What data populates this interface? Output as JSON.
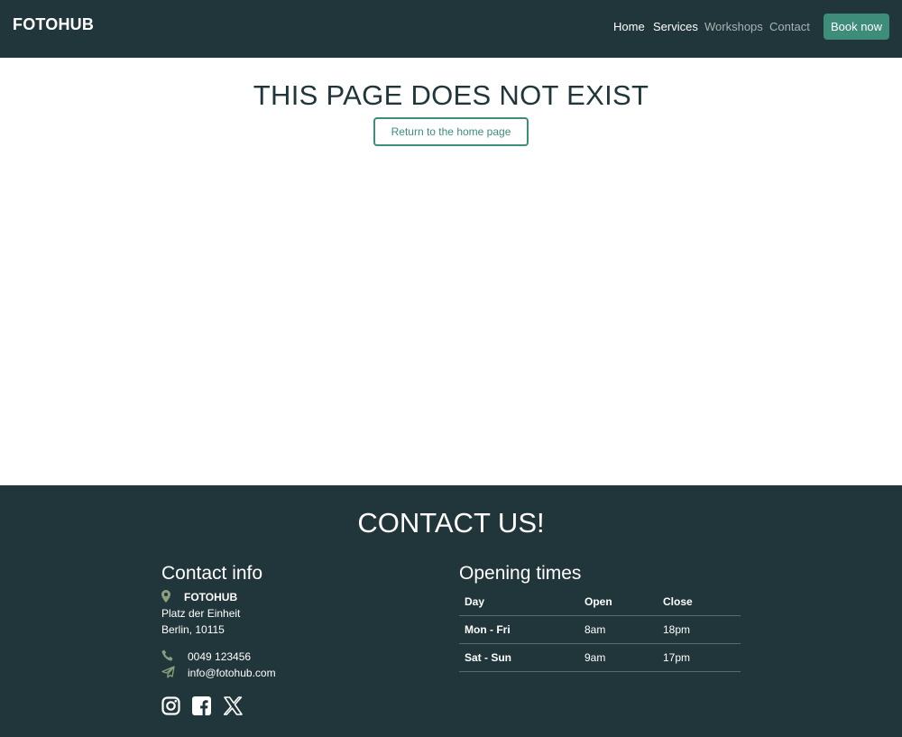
{
  "navbar": {
    "brand": "FOTOHUB",
    "links": [
      {
        "label": "Home"
      },
      {
        "label": "Services"
      },
      {
        "label": "Workshops"
      },
      {
        "label": "Contact"
      }
    ],
    "book_label": "Book now",
    "colors": {
      "background": "#21363a",
      "accent": "#3e8c7a"
    }
  },
  "main": {
    "title": "THIS PAGE DOES NOT EXIST",
    "return_label": "Return to the home page"
  },
  "footer": {
    "title": "CONTACT US!",
    "contact": {
      "heading": "Contact info",
      "name": "FOTOHUB",
      "street": "Platz der Einheit",
      "city": "Berlin, 10115",
      "phone": "0049 123456",
      "email": "info@fotohub.com",
      "icons": [
        "location-pin-icon",
        "phone-icon",
        "paper-plane-icon"
      ],
      "social": [
        "instagram-icon",
        "facebook-icon",
        "x-icon"
      ]
    },
    "hours": {
      "heading": "Opening times",
      "headers": [
        "Day",
        "Open",
        "Close"
      ],
      "rows": [
        [
          "Mon - Fri",
          "8am",
          "18pm"
        ],
        [
          "Sat - Sun",
          "9am",
          "17pm"
        ]
      ]
    }
  }
}
